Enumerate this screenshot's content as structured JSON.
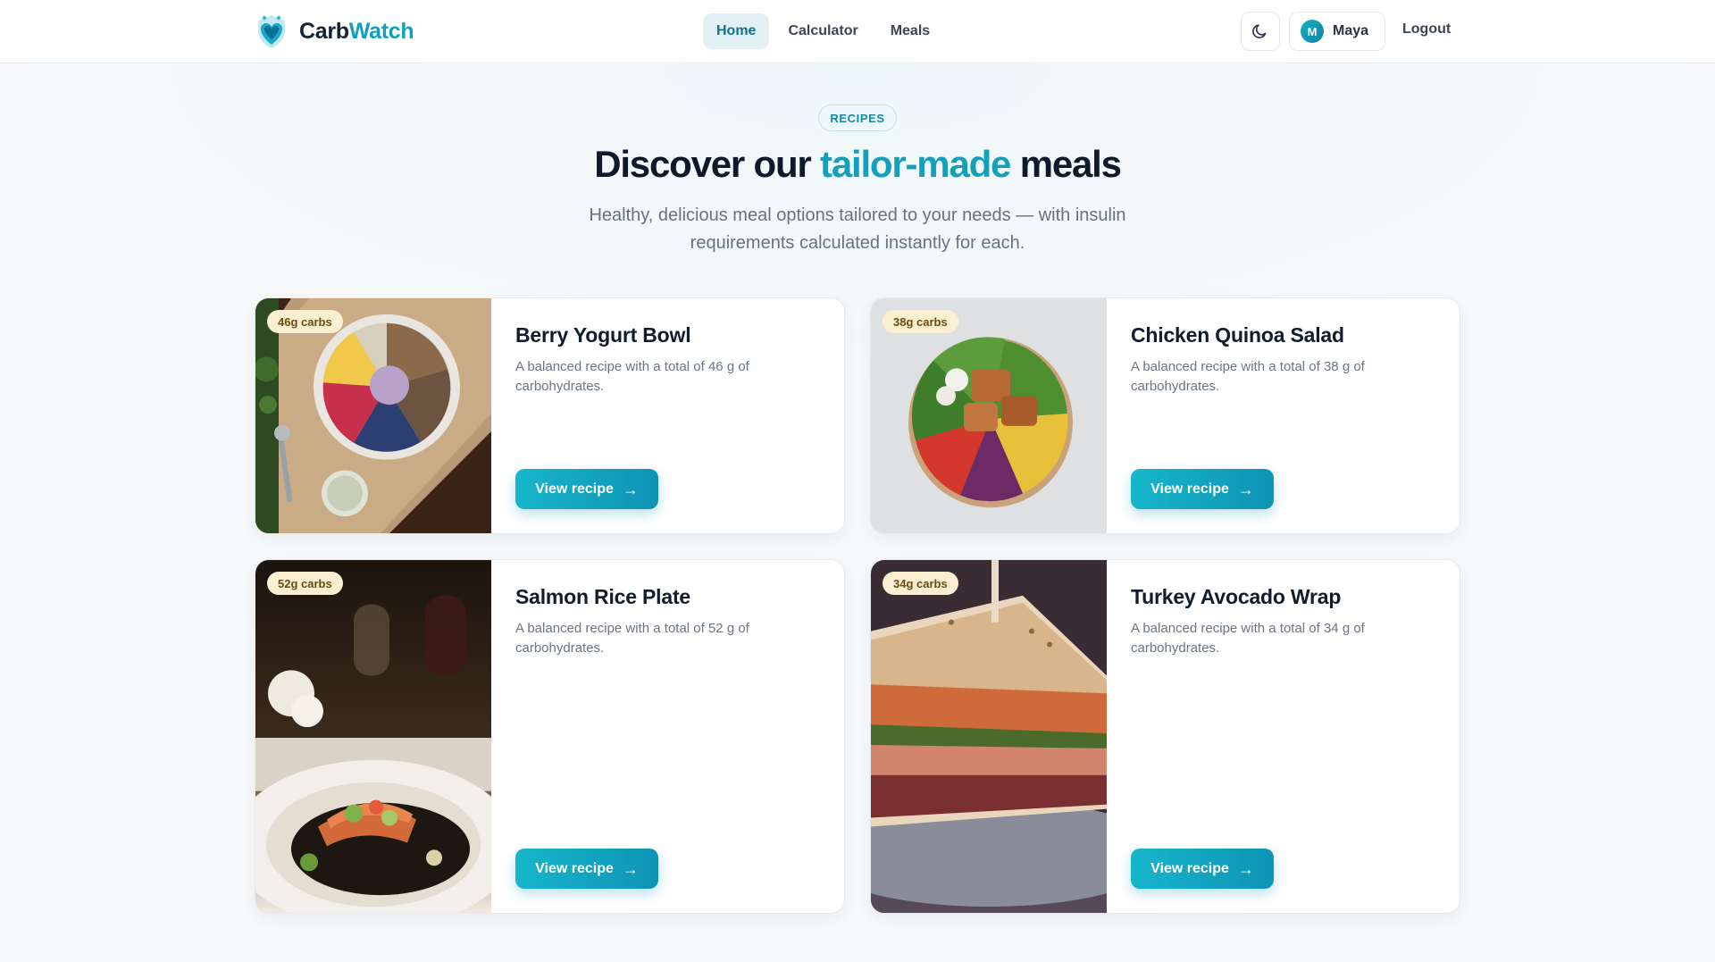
{
  "nav": {
    "brand_a": "Carb",
    "brand_b": "Watch",
    "links": [
      {
        "label": "Home",
        "active": true
      },
      {
        "label": "Calculator",
        "active": false
      },
      {
        "label": "Meals",
        "active": false
      }
    ],
    "theme_icon": "moon-icon",
    "user": {
      "initial": "M",
      "name": "Maya"
    },
    "logout_label": "Logout"
  },
  "hero": {
    "eyebrow": "RECIPES",
    "title_pre": "Discover our ",
    "title_accent": "tailor-made",
    "title_post": " meals",
    "subtitle": "Healthy, delicious meal options tailored to your needs — with insulin requirements calculated instantly for each."
  },
  "colors": {
    "accent": "#149fbd",
    "button_start": "#17b6cb",
    "button_end": "#0e93b4",
    "badge_bg": "#fbefd2"
  },
  "meals": [
    {
      "badge": "46g carbs",
      "title": "Berry Yogurt Bowl",
      "desc": "A balanced recipe with a total of 46 g of carbohydrates.",
      "button": "View recipe",
      "image": "berry-yogurt-bowl-photo"
    },
    {
      "badge": "38g carbs",
      "title": "Chicken Quinoa Salad",
      "desc": "A balanced recipe with a total of 38 g of carbohydrates.",
      "button": "View recipe",
      "image": "chicken-quinoa-salad-photo"
    },
    {
      "badge": "52g carbs",
      "title": "Salmon Rice Plate",
      "desc": "A balanced recipe with a total of 52 g of carbohydrates.",
      "button": "View recipe",
      "image": "salmon-rice-plate-photo"
    },
    {
      "badge": "34g carbs",
      "title": "Turkey Avocado Wrap",
      "desc": "A balanced recipe with a total of 34 g of carbohydrates.",
      "button": "View recipe",
      "image": "turkey-avocado-wrap-photo"
    }
  ]
}
